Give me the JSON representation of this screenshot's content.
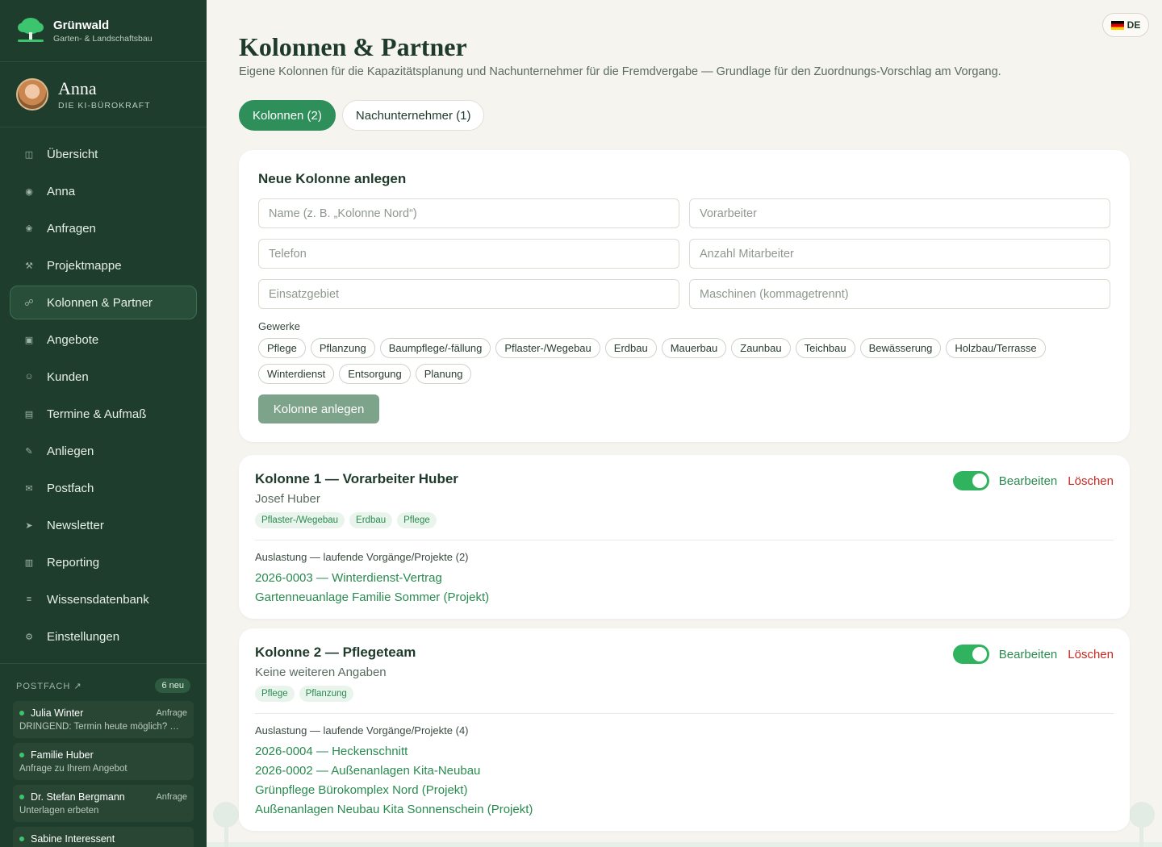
{
  "brand": {
    "name": "Grünwald",
    "subtitle": "Garten- & Landschaftsbau"
  },
  "assistant": {
    "name": "Anna",
    "role": "DIE KI-BÜROKRAFT"
  },
  "nav": [
    {
      "label": "Übersicht",
      "icon": "◫"
    },
    {
      "label": "Anna",
      "icon": "◉"
    },
    {
      "label": "Anfragen",
      "icon": "❀"
    },
    {
      "label": "Projektmappe",
      "icon": "⚒"
    },
    {
      "label": "Kolonnen & Partner",
      "icon": "☍"
    },
    {
      "label": "Angebote",
      "icon": "▣"
    },
    {
      "label": "Kunden",
      "icon": "☺"
    },
    {
      "label": "Termine & Aufmaß",
      "icon": "▤"
    },
    {
      "label": "Anliegen",
      "icon": "✎"
    },
    {
      "label": "Postfach",
      "icon": "✉"
    },
    {
      "label": "Newsletter",
      "icon": "➤"
    },
    {
      "label": "Reporting",
      "icon": "▥"
    },
    {
      "label": "Wissensdatenbank",
      "icon": "≡"
    },
    {
      "label": "Einstellungen",
      "icon": "⚙"
    }
  ],
  "postfach": {
    "title": "POSTFACH ↗",
    "badge": "6 neu",
    "messages": [
      {
        "from": "Julia Winter",
        "tag": "Anfrage",
        "preview": "DRINGEND: Termin heute möglich? …"
      },
      {
        "from": "Familie Huber",
        "tag": "",
        "preview": "Anfrage zu Ihrem Angebot"
      },
      {
        "from": "Dr. Stefan Bergmann",
        "tag": "Anfrage",
        "preview": "Unterlagen erbeten"
      },
      {
        "from": "Sabine Interessent",
        "tag": "",
        "preview": ""
      }
    ]
  },
  "lang": "DE",
  "page": {
    "title": "Kolonnen & Partner",
    "subtitle": "Eigene Kolonnen für die Kapazitätsplanung und Nachunternehmer für die Fremdvergabe — Grundlage für den Zuordnungs-Vorschlag am Vorgang."
  },
  "tabs": [
    {
      "label": "Kolonnen (2)"
    },
    {
      "label": "Nachunternehmer (1)"
    }
  ],
  "form": {
    "title": "Neue Kolonne anlegen",
    "placeholders": {
      "name": "Name (z. B. „Kolonne Nord“)",
      "vorarbeiter": "Vorarbeiter",
      "telefon": "Telefon",
      "anzahl": "Anzahl Mitarbeiter",
      "gebiet": "Einsatzgebiet",
      "maschinen": "Maschinen (kommagetrennt)"
    },
    "gewerke_label": "Gewerke",
    "gewerke": [
      "Pflege",
      "Pflanzung",
      "Baumpflege/-fällung",
      "Pflaster-/Wegebau",
      "Erdbau",
      "Mauerbau",
      "Zaunbau",
      "Teichbau",
      "Bewässerung",
      "Holzbau/Terrasse",
      "Winterdienst",
      "Entsorgung",
      "Planung"
    ],
    "submit": "Kolonne anlegen"
  },
  "kolonnen": [
    {
      "title": "Kolonne 1 — Vorarbeiter Huber",
      "sub": "Josef Huber",
      "tags": [
        "Pflaster-/Wegebau",
        "Erdbau",
        "Pflege"
      ],
      "edit": "Bearbeiten",
      "delete": "Löschen",
      "load_title": "Auslastung — laufende Vorgänge/Projekte (2)",
      "items": [
        "2026-0003 — Winterdienst-Vertrag",
        "Gartenneuanlage Familie Sommer (Projekt)"
      ]
    },
    {
      "title": "Kolonne 2 — Pflegeteam",
      "sub": "Keine weiteren Angaben",
      "tags": [
        "Pflege",
        "Pflanzung"
      ],
      "edit": "Bearbeiten",
      "delete": "Löschen",
      "load_title": "Auslastung — laufende Vorgänge/Projekte (4)",
      "items": [
        "2026-0004 — Heckenschnitt",
        "2026-0002 — Außenanlagen Kita-Neubau",
        "Grünpflege Bürokomplex Nord (Projekt)",
        "Außenanlagen Neubau Kita Sonnenschein (Projekt)"
      ]
    }
  ],
  "colors": {
    "sidebar": "#1f3d2c",
    "accent": "#2f8f5b",
    "toggle": "#2fb35e",
    "danger": "#c9281f"
  }
}
